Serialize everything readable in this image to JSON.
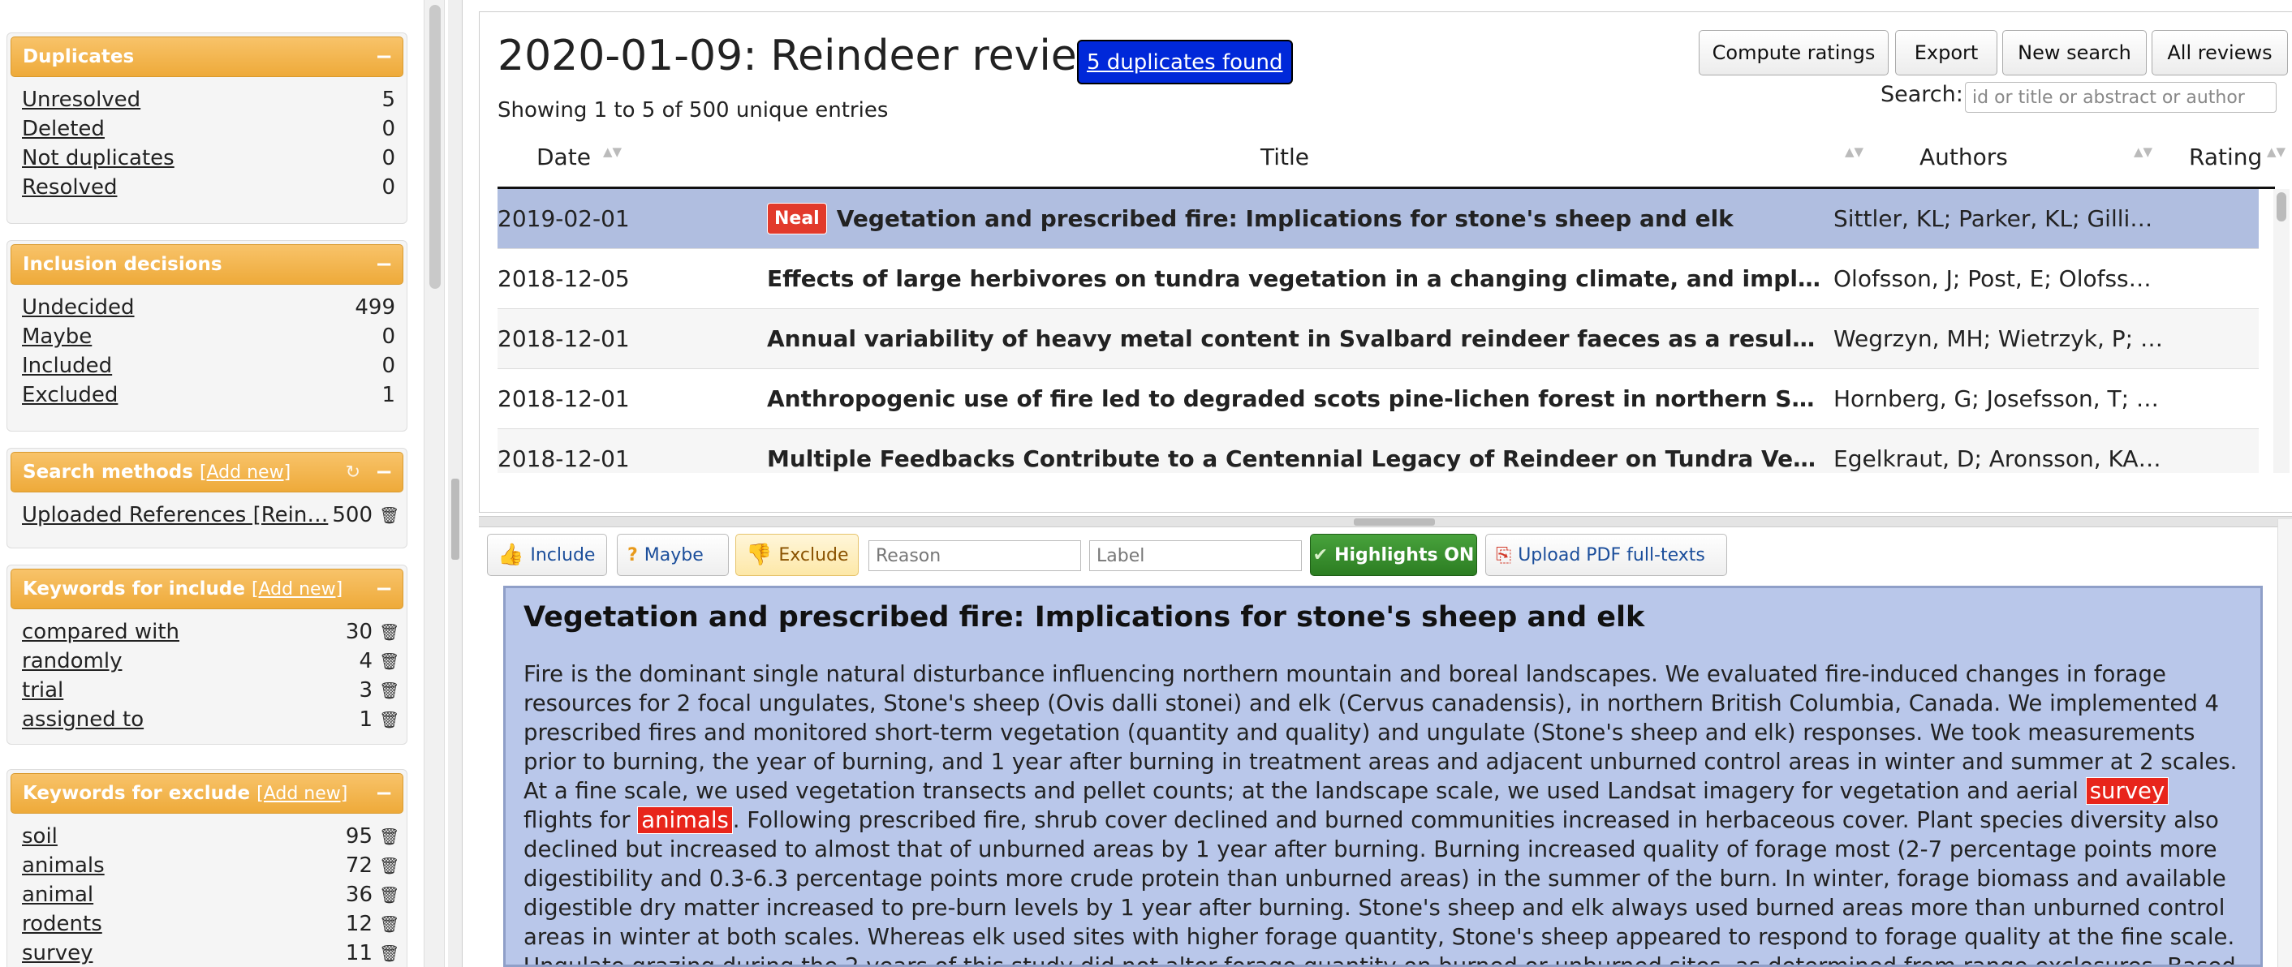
{
  "sidebar": {
    "duplicates": {
      "title": "Duplicates",
      "collapse": "−",
      "items": [
        {
          "label": "Unresolved",
          "count": "5"
        },
        {
          "label": "Deleted",
          "count": "0"
        },
        {
          "label": "Not duplicates",
          "count": "0"
        },
        {
          "label": "Resolved",
          "count": "0"
        }
      ]
    },
    "inclusion": {
      "title": "Inclusion decisions",
      "collapse": "−",
      "items": [
        {
          "label": "Undecided",
          "count": "499"
        },
        {
          "label": "Maybe",
          "count": "0"
        },
        {
          "label": "Included",
          "count": "0"
        },
        {
          "label": "Excluded",
          "count": "1"
        }
      ]
    },
    "search_methods": {
      "title": "Search methods",
      "add": "[Add new]",
      "refresh": "↻",
      "collapse": "−",
      "items": [
        {
          "label": "Uploaded References [Rein…",
          "count": "500",
          "trash": "🗑"
        }
      ]
    },
    "kw_include": {
      "title": "Keywords for include",
      "add": "[Add new]",
      "collapse": "−",
      "items": [
        {
          "label": "compared with",
          "count": "30",
          "trash": "🗑"
        },
        {
          "label": "randomly",
          "count": "4",
          "trash": "🗑"
        },
        {
          "label": "trial",
          "count": "3",
          "trash": "🗑"
        },
        {
          "label": "assigned to",
          "count": "1",
          "trash": "🗑"
        }
      ]
    },
    "kw_exclude": {
      "title": "Keywords for exclude",
      "add": "[Add new]",
      "collapse": "−",
      "items": [
        {
          "label": "soil",
          "count": "95",
          "trash": "🗑"
        },
        {
          "label": "animals",
          "count": "72",
          "trash": "🗑"
        },
        {
          "label": "animal",
          "count": "36",
          "trash": "🗑"
        },
        {
          "label": "rodents",
          "count": "12",
          "trash": "🗑"
        },
        {
          "label": "survey",
          "count": "11",
          "trash": "🗑"
        }
      ]
    }
  },
  "header": {
    "title": "2020-01-09: Reindeer review",
    "duplicates_button": "5 duplicates found",
    "showing": "Showing 1 to 5 of 500 unique entries",
    "buttons": {
      "compute": "Compute ratings",
      "export": "Export",
      "new_search": "New search",
      "all_reviews": "All reviews"
    },
    "search_label": "Search:",
    "search_placeholder": "id or title or abstract or author"
  },
  "table": {
    "columns": {
      "date": "Date",
      "title": "Title",
      "authors": "Authors",
      "rating": "Rating"
    },
    "sort_icon": "▲▼",
    "rows": [
      {
        "date": "2019-02-01",
        "badge": "Neal",
        "title": "Vegetation and prescribed fire: Implications for stone's sheep and elk",
        "authors": "Sittler, KL; Parker, KL; Gillin…",
        "selected": true
      },
      {
        "date": "2018-12-05",
        "title": "Effects of large herbivores on tundra vegetation in a changing climate, and implication…",
        "authors": "Olofsson, J; Post, E; Olofsso…"
      },
      {
        "date": "2018-12-01",
        "title": "Annual variability of heavy metal content in Svalbard reindeer faeces as a result of die…",
        "authors": "Wegrzyn, MH; Wietrzyk, P; …"
      },
      {
        "date": "2018-12-01",
        "title": "Anthropogenic use of fire led to degraded scots pine-lichen forest in northern Sweden",
        "authors": "Hornberg, G; Josefsson, T; …"
      },
      {
        "date": "2018-12-01",
        "title": "Multiple Feedbacks Contribute to a Centennial Legacy of Reindeer on Tundra Vegetation",
        "authors": "Egelkraut, D; Aronsson, KA; …"
      }
    ]
  },
  "actions": {
    "include": "Include",
    "maybe": "Maybe",
    "exclude": "Exclude",
    "reason_placeholder": "Reason",
    "label_placeholder": "Label",
    "highlights": "Highlights ON",
    "upload": "Upload PDF full-texts"
  },
  "abstract": {
    "title": "Vegetation and prescribed fire: Implications for stone's sheep and elk",
    "part1": "Fire is the dominant single natural disturbance influencing northern mountain and boreal landscapes. We evaluated fire-induced changes in forage resources for 2 focal ungulates, Stone's sheep (Ovis dalli stonei) and elk (Cervus canadensis), in northern British Columbia, Canada. We implemented 4 prescribed fires and monitored short-term vegetation (quantity and quality) and ungulate (Stone's sheep and elk) responses. We took measurements prior to burning, the year of burning, and 1 year after burning in treatment areas and adjacent unburned control areas in winter and summer at 2 scales. At a fine scale, we used vegetation transects and pellet counts; at the landscape scale, we used Landsat imagery for vegetation and aerial",
    "hl1": "survey",
    "part2": "flights for",
    "hl2": "animals",
    "part3": ". Following prescribed fire, shrub cover declined and burned communities increased in herbaceous cover. Plant species diversity also declined but increased to almost that of unburned areas by 1 year after burning. Burning increased quality of forage most (2-7 percentage points more digestibility and 0.3-6.3 percentage points more crude protein than unburned areas) in the summer of the burn. In winter, forage biomass and available digestible dry matter increased to pre-burn levels by 1 year after burning. Stone's sheep and elk always used burned areas more than unburned control areas in winter at both scales. Whereas elk used sites with higher forage quantity, Stone's sheep appeared to respond to forage quality at the fine scale. Ungulate grazing during the 2 years of this study did not alter forage quantity on burned or unburned sites, as determined from range exclosures. Based on our findings in this area, maximum benefits to elk would be achieved"
  },
  "colors": {
    "accent": "#eeaa3a",
    "selected_row": "#b0bee0",
    "abstract_bg": "#b9c7ea",
    "highlight": "#e8251b",
    "dup_button": "#0028d9"
  }
}
